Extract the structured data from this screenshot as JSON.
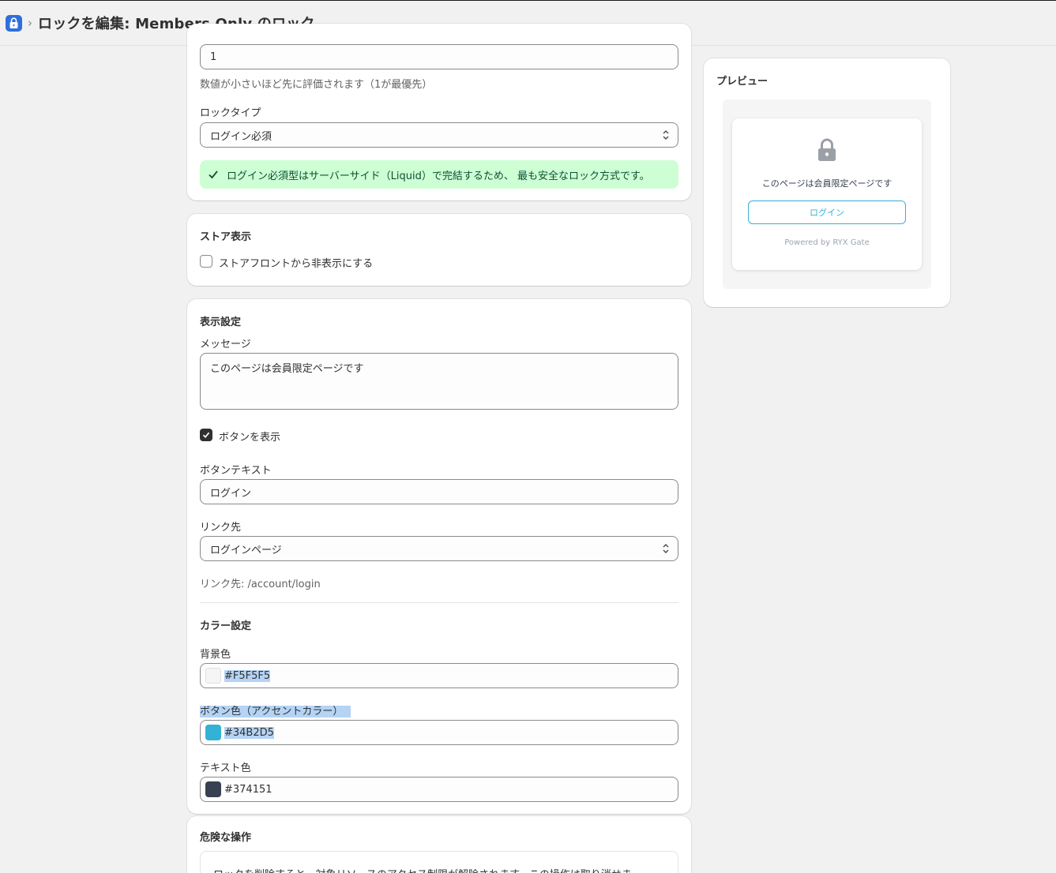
{
  "header": {
    "title": "ロックを編集: Members Only のロック",
    "separator": "›"
  },
  "priority_card": {
    "priority_value": "1",
    "priority_help": "数値が小さいほど先に評価されます（1が最優先）",
    "lock_type_label": "ロックタイプ",
    "lock_type_value": "ログイン必須",
    "banner_text": "ログイン必須型はサーバーサイド（Liquid）で完結するため、 最も安全なロック方式です。"
  },
  "store_card": {
    "title": "ストア表示",
    "hide_label": "ストアフロントから非表示にする",
    "hide_checked": false
  },
  "display_card": {
    "title": "表示設定",
    "message_label": "メッセージ",
    "message_value": "このページは会員限定ページです",
    "show_button_label": "ボタンを表示",
    "show_button_checked": true,
    "button_text_label": "ボタンテキスト",
    "button_text_value": "ログイン",
    "link_label": "リンク先",
    "link_value": "ログインページ",
    "link_help": "リンク先: /account/login",
    "color_title": "カラー設定",
    "bg_label": "背景色",
    "bg_value": "#F5F5F5",
    "accent_label": "ボタン色（アクセントカラー）",
    "accent_value": "#34B2D5",
    "text_label": "テキスト色",
    "text_value": "#374151"
  },
  "danger_card": {
    "title": "危険な操作",
    "description": "ロックを削除すると、対象リソースのアクセス制限が解除されます。この操作は取り消せま"
  },
  "preview": {
    "title": "プレビュー",
    "message": "このページは会員限定ページです",
    "button": "ログイン",
    "powered_by": "Powered by RYX Gate"
  },
  "colors": {
    "background": "#F5F5F5",
    "accent": "#34B2D5",
    "text": "#374151",
    "success_bg": "#CDFED4",
    "app_icon": "#2F6FDC"
  },
  "icons": {
    "app": "lock-app-icon",
    "banner": "checkmark-icon",
    "preview": "lock-icon"
  }
}
